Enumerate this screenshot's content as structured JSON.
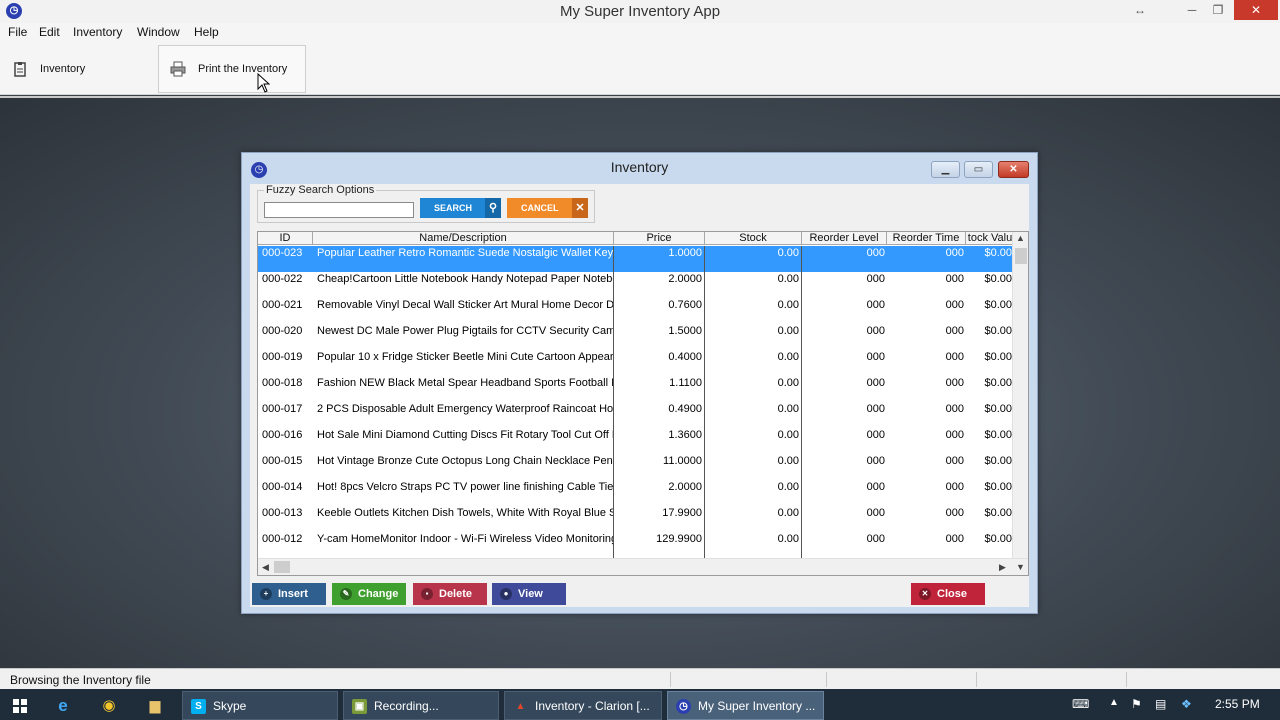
{
  "window": {
    "title": "My Super Inventory App"
  },
  "menu": [
    "File",
    "Edit",
    "Inventory",
    "Window",
    "Help"
  ],
  "toolbar": {
    "inventory_label": "Inventory",
    "print_label": "Print the Inventory"
  },
  "dialog": {
    "title": "Inventory",
    "search_group": "Fuzzy Search Options",
    "search_value": "",
    "search_label": "SEARCH",
    "cancel_label": "CANCEL",
    "columns": [
      "ID",
      "Name/Description",
      "Price",
      "Stock",
      "Reorder Level",
      "Reorder Time",
      "tock Valu"
    ],
    "rows": [
      {
        "id": "000-023",
        "name": "Popular Leather Retro Romantic Suede Nostalgic Wallet Key C",
        "price": "1.0000",
        "stock": "0.00",
        "rlevel": "000",
        "rtime": "000",
        "value": "$0.00"
      },
      {
        "id": "000-022",
        "name": "Cheap!Cartoon Little Notebook Handy Notepad Paper Notebo",
        "price": "2.0000",
        "stock": "0.00",
        "rlevel": "000",
        "rtime": "000",
        "value": "$0.00"
      },
      {
        "id": "000-021",
        "name": "Removable Vinyl Decal Wall Sticker Art Mural Home Decor DIY",
        "price": "0.7600",
        "stock": "0.00",
        "rlevel": "000",
        "rtime": "000",
        "value": "$0.00"
      },
      {
        "id": "000-020",
        "name": "Newest DC Male Power Plug Pigtails for CCTV Security Camera",
        "price": "1.5000",
        "stock": "0.00",
        "rlevel": "000",
        "rtime": "000",
        "value": "$0.00"
      },
      {
        "id": "000-019",
        "name": "Popular 10 x Fridge Sticker Beetle Mini Cute Cartoon Appearan",
        "price": "0.4000",
        "stock": "0.00",
        "rlevel": "000",
        "rtime": "000",
        "value": "$0.00"
      },
      {
        "id": "000-018",
        "name": "Fashion NEW Black Metal Spear Headband Sports Football ME",
        "price": "1.1100",
        "stock": "0.00",
        "rlevel": "000",
        "rtime": "000",
        "value": "$0.00"
      },
      {
        "id": "000-017",
        "name": "2 PCS Disposable Adult Emergency Waterproof Raincoat Hooc",
        "price": "0.4900",
        "stock": "0.00",
        "rlevel": "000",
        "rtime": "000",
        "value": "$0.00"
      },
      {
        "id": "000-016",
        "name": "Hot Sale Mini Diamond Cutting Discs Fit Rotary Tool Cut Off Ne",
        "price": "1.3600",
        "stock": "0.00",
        "rlevel": "000",
        "rtime": "000",
        "value": "$0.00"
      },
      {
        "id": "000-015",
        "name": "Hot Vintage Bronze Cute Octopus Long Chain Necklace Penda",
        "price": "11.0000",
        "stock": "0.00",
        "rlevel": "000",
        "rtime": "000",
        "value": "$0.00"
      },
      {
        "id": "000-014",
        "name": "Hot! 8pcs Velcro Straps PC TV power line finishing Cable Ties,F",
        "price": "2.0000",
        "stock": "0.00",
        "rlevel": "000",
        "rtime": "000",
        "value": "$0.00"
      },
      {
        "id": "000-013",
        "name": "Keeble Outlets Kitchen Dish Towels, White With Royal Blue Str",
        "price": "17.9900",
        "stock": "0.00",
        "rlevel": "000",
        "rtime": "000",
        "value": "$0.00"
      },
      {
        "id": "000-012",
        "name": "Y-cam HomeMonitor Indoor - Wi-Fi Wireless Video Monitoring C",
        "price": "129.9900",
        "stock": "0.00",
        "rlevel": "000",
        "rtime": "000",
        "value": "$0.00"
      }
    ],
    "actions": {
      "insert": "Insert",
      "change": "Change",
      "delete": "Delete",
      "view": "View",
      "close": "Close"
    }
  },
  "status": {
    "text": "Browsing the Inventory file"
  },
  "taskbar": {
    "items": [
      "Skype",
      "Recording...",
      "Inventory - Clarion [...",
      "My Super Inventory ..."
    ],
    "time": "2:55 PM"
  },
  "colors": {
    "selected_row": "#3399ff",
    "insert": "#2f5f8f",
    "change": "#3fa02f",
    "delete": "#b8344a",
    "view": "#3f4a9a",
    "close": "#c0243a"
  }
}
